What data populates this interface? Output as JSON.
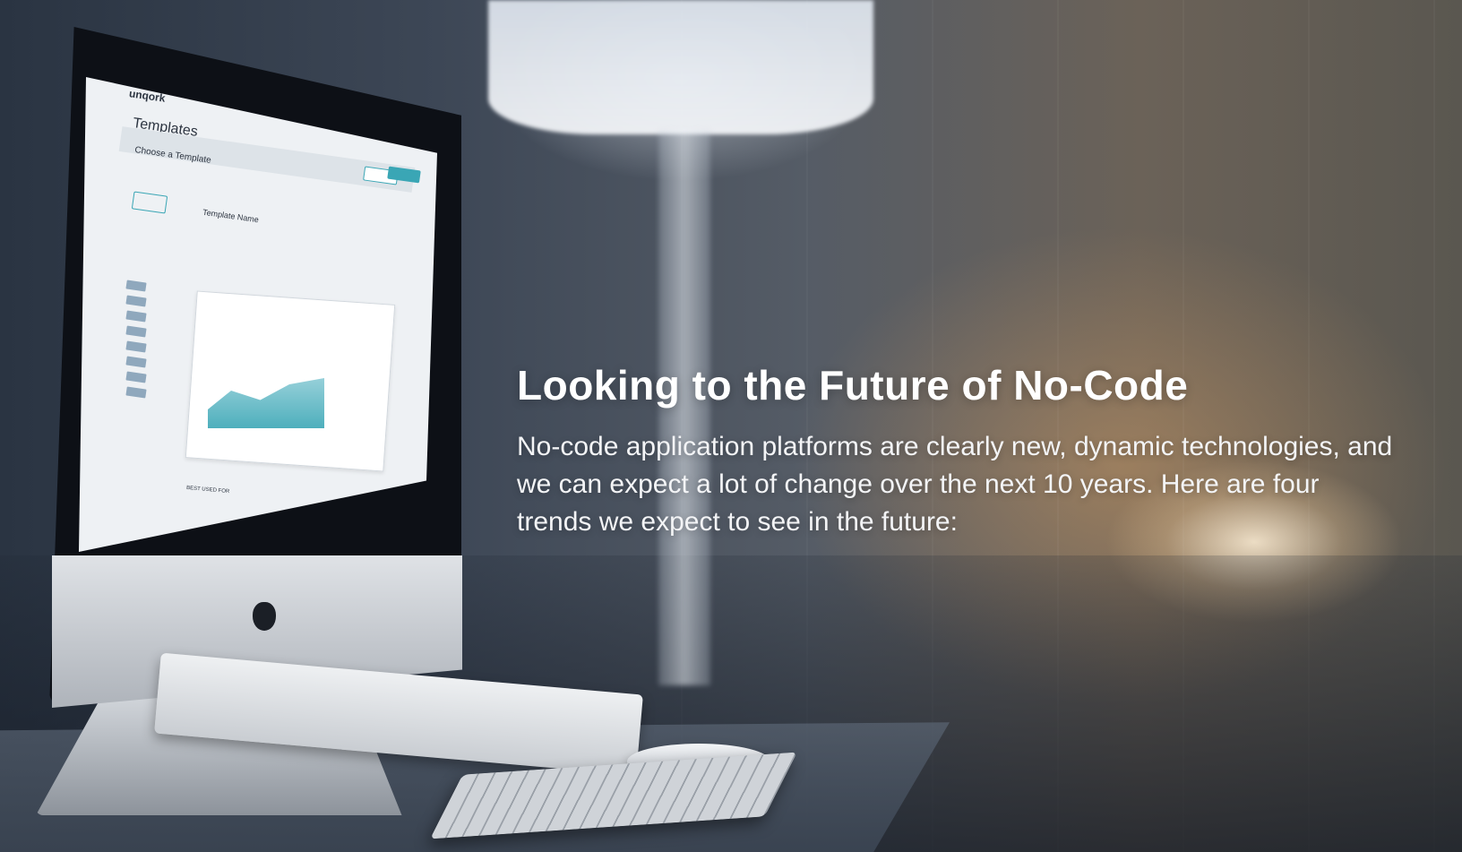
{
  "hero": {
    "headline": "Looking to the Future of No-Code",
    "body": "No-code application platforms are clearly new, dynamic technologies, and we can expect a lot of change over the next 10 years. Here are four trends we expect to see in the future:"
  },
  "photo": {
    "screen": {
      "logo": "unqork",
      "page_title": "Templates",
      "subtitle": "Choose a Template",
      "template_heading": "Template Name",
      "best_used_for": "BEST USED FOR"
    }
  },
  "colors": {
    "accent": "#3aa6b5",
    "headline_text": "#ffffff",
    "body_text": "#f3f4f6"
  }
}
